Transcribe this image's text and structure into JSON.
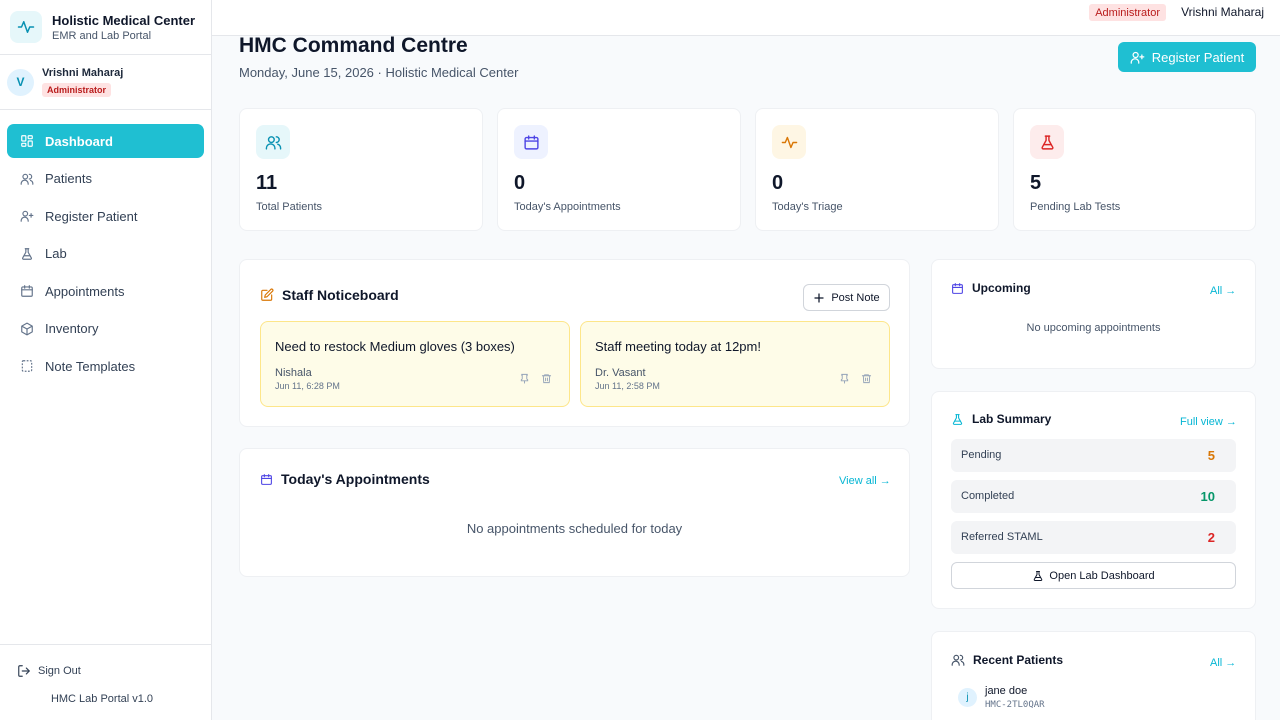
{
  "brand": {
    "title": "Holistic Medical Center",
    "subtitle": "EMR and Lab Portal"
  },
  "user": {
    "initial": "V",
    "name": "Vrishni Maharaj",
    "role": "Administrator"
  },
  "nav": {
    "items": [
      {
        "label": "Dashboard",
        "icon": "grid-icon",
        "active": true
      },
      {
        "label": "Patients",
        "icon": "users-icon"
      },
      {
        "label": "Register Patient",
        "icon": "user-plus-icon"
      },
      {
        "label": "Lab",
        "icon": "flask-icon"
      },
      {
        "label": "Appointments",
        "icon": "calendar-icon"
      },
      {
        "label": "Inventory",
        "icon": "box-icon"
      },
      {
        "label": "Note Templates",
        "icon": "template-icon"
      }
    ]
  },
  "footer": {
    "sign_out": "Sign Out",
    "version": "HMC Lab Portal v1.0"
  },
  "topbar": {
    "role": "Administrator",
    "user_name": "Vrishni Maharaj"
  },
  "header": {
    "title": "HMC Command Centre",
    "subtitle": "Monday, June 15, 2026 · Holistic Medical Center",
    "register_button": "Register Patient"
  },
  "stats": [
    {
      "value": "11",
      "label": "Total Patients",
      "icon": "users-icon"
    },
    {
      "value": "0",
      "label": "Today's Appointments",
      "icon": "calendar-icon"
    },
    {
      "value": "0",
      "label": "Today's Triage",
      "icon": "activity-icon"
    },
    {
      "value": "5",
      "label": "Pending Lab Tests",
      "icon": "flask-icon"
    }
  ],
  "noticeboard": {
    "title": "Staff Noticeboard",
    "post_button": "Post Note",
    "notes": [
      {
        "text": "Need to restock Medium gloves (3 boxes)",
        "author": "Nishala",
        "date": "Jun 11, 6:28 PM"
      },
      {
        "text": "Staff meeting today at 12pm!",
        "author": "Dr. Vasant",
        "date": "Jun 11, 2:58 PM"
      }
    ]
  },
  "appointments": {
    "title": "Today's Appointments",
    "view_all": "View all →",
    "empty": "No appointments scheduled for today"
  },
  "upcoming": {
    "title": "Upcoming",
    "link": "All →",
    "empty": "No upcoming appointments"
  },
  "lab_summary": {
    "title": "Lab Summary",
    "link": "Full view →",
    "rows": [
      {
        "label": "Pending",
        "value": "5"
      },
      {
        "label": "Completed",
        "value": "10"
      },
      {
        "label": "Referred STAML",
        "value": "2"
      }
    ],
    "button": "Open Lab Dashboard"
  },
  "recent_patients": {
    "title": "Recent Patients",
    "link": "All →",
    "patients": [
      {
        "initial": "j",
        "name": "jane doe",
        "id": "HMC-2TL0QAR"
      }
    ]
  },
  "colors": {
    "accent": "#1fbfd2",
    "pending": "#d97706",
    "completed": "#059669",
    "referred": "#dc2626",
    "note_bg": "#fefce8"
  }
}
